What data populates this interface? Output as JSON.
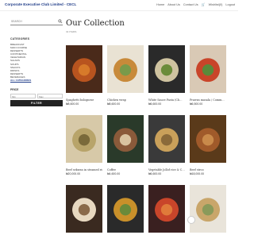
{
  "header": {
    "brand": "Corporate Executive Club Limited - CECL",
    "nav": [
      "Home",
      "About Us",
      "Contact Us",
      "Wishlist(0)",
      "Logout"
    ],
    "cart_icon": "cart-icon"
  },
  "sidebar": {
    "search_placeholder": "SEARCH",
    "categories_heading": "CATEGORIES",
    "categories": [
      "BREAKFAST",
      "MAIN COURSE",
      "DESSERTS",
      "CONTINENTAL",
      "VEGETARIAN",
      "SALADS",
      "SOUPS",
      "SNACKS",
      "DRINKS",
      "DESSERTS",
      "BEVERAGES",
      "ALL CATEGORIES"
    ],
    "active_category_index": 11,
    "price_heading": "PRICE",
    "price_min_placeholder": "Min",
    "price_max_placeholder": "Max",
    "filter_label": "FILTER"
  },
  "main": {
    "title": "Our Collection",
    "count": "32 ITEMS",
    "products": [
      {
        "tags": "",
        "name": "Spaghetti bolognese",
        "price": "₦8,600.00",
        "colors": [
          "#4a2a1a",
          "#b8541f",
          "#d77a2a"
        ]
      },
      {
        "tags": "",
        "name": "Chicken wrap",
        "price": "₦8,600.00",
        "colors": [
          "#e9e2d3",
          "#c88a3a",
          "#7a9a4a"
        ]
      },
      {
        "tags": "",
        "name": "White Sauce Pasta (Ch…",
        "price": "₦6,600.00",
        "colors": [
          "#2a2a2a",
          "#cfc3a0",
          "#6b8c3a"
        ]
      },
      {
        "tags": "",
        "name": "Prawns masala / Comm…",
        "price": "₦6,500.00",
        "colors": [
          "#d9c9b5",
          "#c9452a",
          "#5a8a3a"
        ]
      },
      {
        "tags": "",
        "name": "Beef sekwan in steamed rice",
        "price": "₦20,000.00",
        "colors": [
          "#d7c9a8",
          "#b8a46a",
          "#7a6a3a"
        ]
      },
      {
        "tags": "",
        "name": "Coffee",
        "price": "₦4,600.00",
        "colors": [
          "#2a3a2a",
          "#8a5a3a",
          "#d9c3a0"
        ]
      },
      {
        "tags": "",
        "name": "Vegetable Jollof rice & C…",
        "price": "₦6,600.00",
        "colors": [
          "#3a3a3a",
          "#c9a05a",
          "#8a6a3a"
        ]
      },
      {
        "tags": "",
        "name": "Beef stroo",
        "price": "₦18,000.00",
        "colors": [
          "#5a3a1a",
          "#a05a2a",
          "#c98a4a"
        ]
      },
      {
        "tags": "",
        "name": "",
        "price": "",
        "colors": [
          "#3a2a20",
          "#e7d8c0",
          "#8a6a4a"
        ]
      },
      {
        "tags": "",
        "name": "",
        "price": "",
        "colors": [
          "#2a2a2a",
          "#c9902a",
          "#6a8a3a"
        ]
      },
      {
        "tags": "",
        "name": "",
        "price": "",
        "colors": [
          "#3a2020",
          "#c9452a",
          "#e07a3a"
        ]
      },
      {
        "tags": "",
        "name": "",
        "price": "",
        "colors": [
          "#e9e4da",
          "#c9a66a",
          "#8a9a5a"
        ]
      }
    ]
  }
}
